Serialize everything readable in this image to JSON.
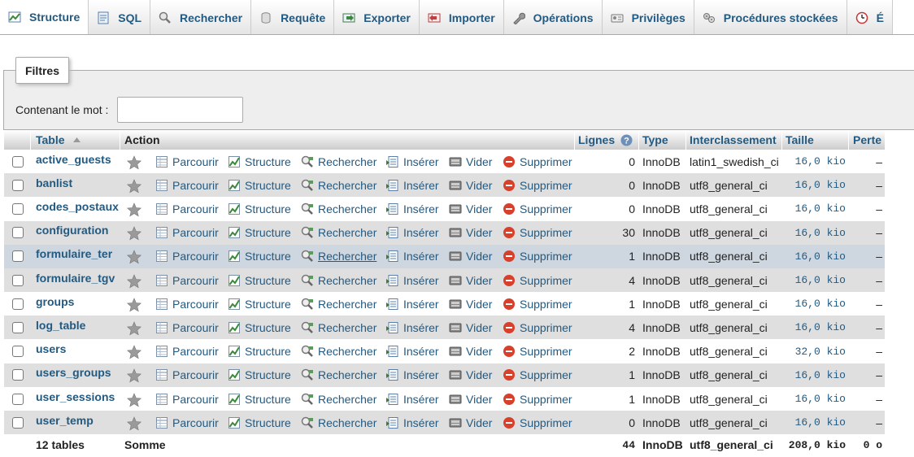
{
  "tabs": [
    {
      "label": "Structure",
      "icon": "structure-icon",
      "active": true
    },
    {
      "label": "SQL",
      "icon": "sql-icon"
    },
    {
      "label": "Rechercher",
      "icon": "search-icon"
    },
    {
      "label": "Requête",
      "icon": "query-icon"
    },
    {
      "label": "Exporter",
      "icon": "export-icon"
    },
    {
      "label": "Importer",
      "icon": "import-icon"
    },
    {
      "label": "Opérations",
      "icon": "wrench-icon"
    },
    {
      "label": "Privilèges",
      "icon": "privileges-icon"
    },
    {
      "label": "Procédures stockées",
      "icon": "routines-icon"
    },
    {
      "label": "É",
      "icon": "events-icon"
    }
  ],
  "filters": {
    "legend": "Filtres",
    "label": "Contenant le mot :",
    "value": ""
  },
  "columns": {
    "table": "Table",
    "action": "Action",
    "rows": "Lignes",
    "type": "Type",
    "collation": "Interclassement",
    "size": "Taille",
    "overhead": "Perte"
  },
  "actions": {
    "browse": "Parcourir",
    "structure": "Structure",
    "search": "Rechercher",
    "insert": "Insérer",
    "empty": "Vider",
    "drop": "Supprimer"
  },
  "tables": [
    {
      "name": "active_guests",
      "rows": "0",
      "type": "InnoDB",
      "collation": "latin1_swedish_ci",
      "size": "16,0 kio",
      "overhead": "–"
    },
    {
      "name": "banlist",
      "rows": "0",
      "type": "InnoDB",
      "collation": "utf8_general_ci",
      "size": "16,0 kio",
      "overhead": "–"
    },
    {
      "name": "codes_postaux",
      "rows": "0",
      "type": "InnoDB",
      "collation": "utf8_general_ci",
      "size": "16,0 kio",
      "overhead": "–"
    },
    {
      "name": "configuration",
      "rows": "30",
      "type": "InnoDB",
      "collation": "utf8_general_ci",
      "size": "16,0 kio",
      "overhead": "–"
    },
    {
      "name": "formulaire_ter",
      "rows": "1",
      "type": "InnoDB",
      "collation": "utf8_general_ci",
      "size": "16,0 kio",
      "overhead": "–"
    },
    {
      "name": "formulaire_tgv",
      "rows": "4",
      "type": "InnoDB",
      "collation": "utf8_general_ci",
      "size": "16,0 kio",
      "overhead": "–"
    },
    {
      "name": "groups",
      "rows": "1",
      "type": "InnoDB",
      "collation": "utf8_general_ci",
      "size": "16,0 kio",
      "overhead": "–"
    },
    {
      "name": "log_table",
      "rows": "4",
      "type": "InnoDB",
      "collation": "utf8_general_ci",
      "size": "16,0 kio",
      "overhead": "–"
    },
    {
      "name": "users",
      "rows": "2",
      "type": "InnoDB",
      "collation": "utf8_general_ci",
      "size": "32,0 kio",
      "overhead": "–"
    },
    {
      "name": "users_groups",
      "rows": "1",
      "type": "InnoDB",
      "collation": "utf8_general_ci",
      "size": "16,0 kio",
      "overhead": "–"
    },
    {
      "name": "user_sessions",
      "rows": "1",
      "type": "InnoDB",
      "collation": "utf8_general_ci",
      "size": "16,0 kio",
      "overhead": "–"
    },
    {
      "name": "user_temp",
      "rows": "0",
      "type": "InnoDB",
      "collation": "utf8_general_ci",
      "size": "16,0 kio",
      "overhead": "–"
    }
  ],
  "footer": {
    "count": "12 tables",
    "label": "Somme",
    "rows": "44",
    "type": "InnoDB",
    "collation": "utf8_general_ci",
    "size": "208,0 kio",
    "overhead": "0 o"
  },
  "colors": {
    "link": "#235a81",
    "row_alt": "#dfdfdf",
    "row_hover": "#ced6df",
    "drop": "#d9402b"
  }
}
